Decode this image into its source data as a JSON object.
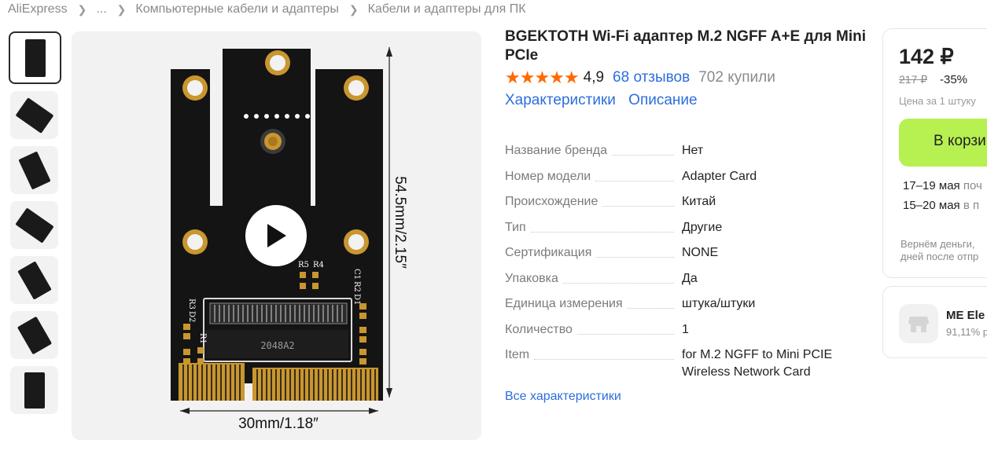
{
  "breadcrumb": [
    "AliExpress",
    "...",
    "Компьютерные кабели и адаптеры",
    "Кабели и адаптеры для ПК"
  ],
  "gallery": {
    "thumb_count": 7,
    "dim_height": "54.5mm/2.15″",
    "dim_width": "30mm/1.18″",
    "chip_label": "2048A2",
    "silk": {
      "r5": "R5",
      "r4": "R4",
      "c1": "C1",
      "r2": "R2",
      "d1": "D1",
      "r3": "R3",
      "d2": "D2",
      "r1": "R1"
    }
  },
  "product": {
    "title": "BGEKTOTH Wi-Fi адаптер M.2 NGFF A+E для Mini PCIe",
    "stars": "★★★★★",
    "rating": "4,9",
    "reviews": "68 отзывов",
    "bought": "702 купили",
    "links": [
      "Характеристики",
      "Описание"
    ]
  },
  "specs": [
    {
      "key": "Название бренда",
      "value": "Нет"
    },
    {
      "key": "Номер модели",
      "value": "Adapter Card"
    },
    {
      "key": "Происхождение",
      "value": "Китай"
    },
    {
      "key": "Тип",
      "value": "Другие"
    },
    {
      "key": "Сертификация",
      "value": "NONE"
    },
    {
      "key": "Упаковка",
      "value": "Да"
    },
    {
      "key": "Единица измерения",
      "value": "штука/штуки"
    },
    {
      "key": "Количество",
      "value": "1"
    },
    {
      "key": "Item",
      "value": "for M.2 NGFF to Mini PCIE Wireless Network Card"
    }
  ],
  "all_specs_link": "Все характеристики",
  "buy": {
    "price": "142 ₽",
    "old_price": "217 ₽",
    "discount": "-35%",
    "unit_price": "Цена за 1 штуку",
    "cart_button": "В корзи",
    "delivery": [
      {
        "date": "17–19 мая",
        "method": "поч"
      },
      {
        "date": "15–20 мая",
        "method": "в п"
      }
    ],
    "refund_line1": "Вернём деньги,",
    "refund_line2": "дней после отпр"
  },
  "seller": {
    "name": "ME Ele",
    "rating": "91,11% p"
  },
  "colors": {
    "accent": "#2d6edd",
    "stars": "#ff6a00",
    "cart": "#b7f051",
    "board": "#141414",
    "gold": "#c9962f"
  }
}
